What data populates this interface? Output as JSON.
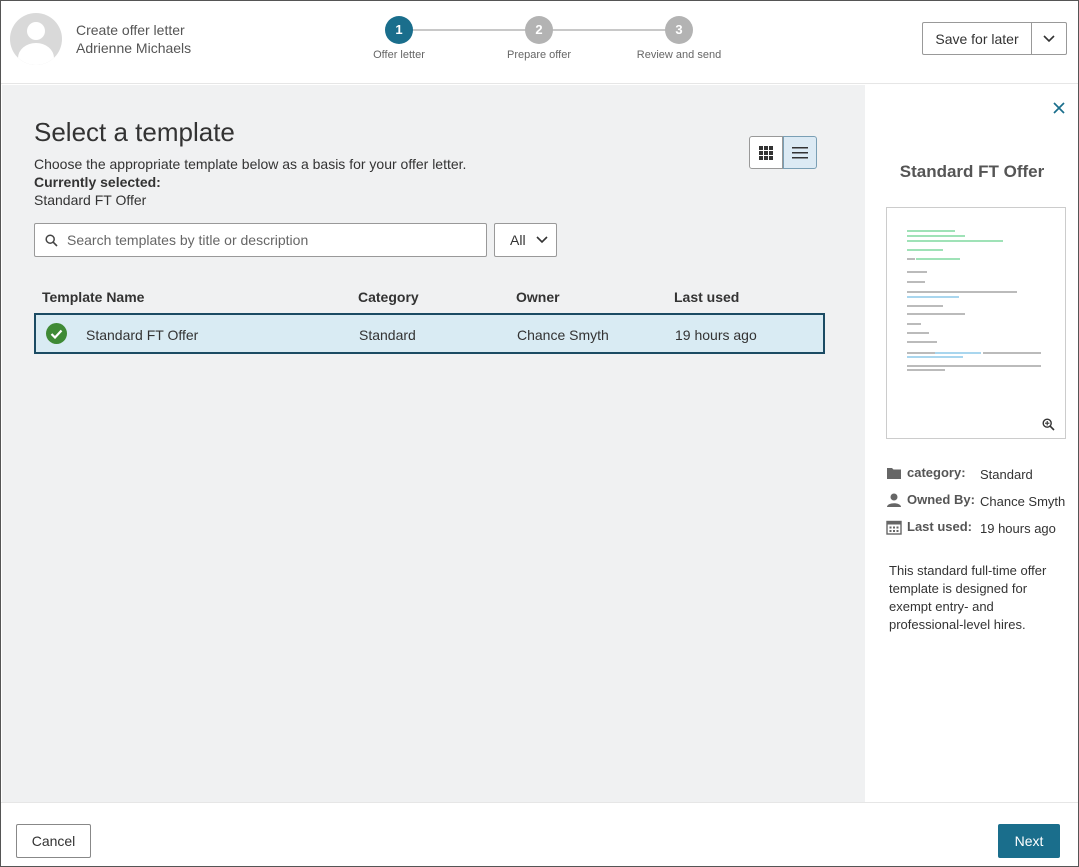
{
  "header": {
    "title": "Create offer letter",
    "candidate_name": "Adrienne Michaels",
    "steps": [
      {
        "number": "1",
        "label": "Offer letter",
        "active": true
      },
      {
        "number": "2",
        "label": "Prepare offer",
        "active": false
      },
      {
        "number": "3",
        "label": "Review and send",
        "active": false
      }
    ],
    "save_label": "Save for later"
  },
  "main": {
    "title": "Select a template",
    "description": "Choose the appropriate template below as a basis for your offer letter.",
    "currently_selected_label": "Currently selected:",
    "currently_selected_value": "Standard FT Offer",
    "search_placeholder": "Search templates by title or description",
    "filter_value": "All",
    "view_mode": "list",
    "columns": [
      "Template Name",
      "Category",
      "Owner",
      "Last used"
    ],
    "rows": [
      {
        "name": "Standard FT Offer",
        "category": "Standard",
        "owner": "Chance Smyth",
        "last_used": "19 hours ago",
        "selected": true
      }
    ]
  },
  "panel": {
    "title": "Standard FT Offer",
    "category_label": "category:",
    "category_value": "Standard",
    "owner_label": "Owned By:",
    "owner_value": "Chance Smyth",
    "last_used_label": "Last used:",
    "last_used_value": "19 hours ago",
    "description": "This standard full-time offer template is designed for exempt entry- and professional-level hires."
  },
  "footer": {
    "cancel_label": "Cancel",
    "next_label": "Next"
  },
  "colors": {
    "accent": "#1a6e8c",
    "selected_row_bg": "#d9ebf3",
    "selected_row_border": "#1b4b63",
    "check_green": "#3f8a35",
    "main_bg": "#f0f1f2"
  }
}
